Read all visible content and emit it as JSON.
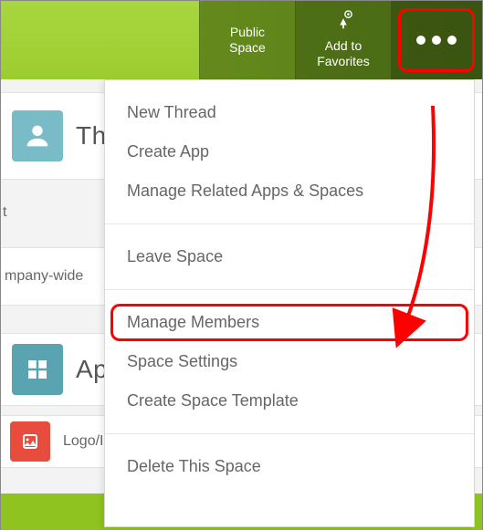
{
  "topbar": {
    "public_space": "Public\nSpace",
    "add_favorites": "Add to\nFavorites"
  },
  "background": {
    "threads_title": "Thr",
    "row_label": "t",
    "company_wide": "mpany-wide",
    "apps_title": "Ap",
    "logo_row": "Logo/Im"
  },
  "menu": {
    "group1": {
      "new_thread": "New Thread",
      "create_app": "Create App",
      "manage_related": "Manage Related Apps & Spaces"
    },
    "group2": {
      "leave_space": "Leave Space"
    },
    "group3": {
      "manage_members": "Manage Members",
      "space_settings": "Space Settings",
      "create_template": "Create Space Template"
    },
    "group4": {
      "delete_space": "Delete This Space"
    }
  },
  "colors": {
    "highlight": "#ff0000",
    "brand_green": "#9ccd2f"
  }
}
